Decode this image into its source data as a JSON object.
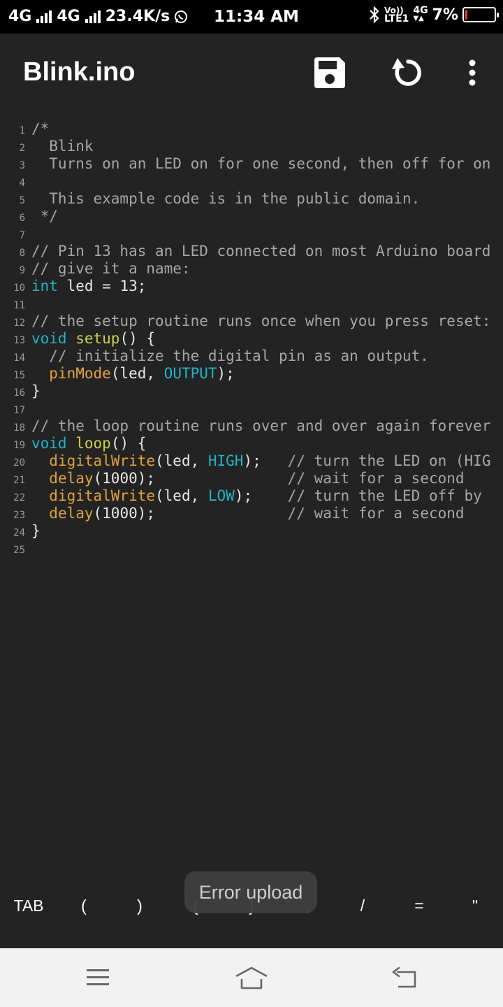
{
  "status_bar": {
    "net1": "4G",
    "net2": "4G",
    "speed": "23.4K/s",
    "time": "11:34 AM",
    "volte_top": "Vo))",
    "volte_bottom": "LTE1",
    "net3": "4G",
    "battery": "7%",
    "battery_level": 0.07,
    "battery_color": "#e53935"
  },
  "toolbar": {
    "title": "Blink.ino",
    "save_icon": "save-icon",
    "refresh_icon": "refresh-icon",
    "more_icon": "more-vertical-icon"
  },
  "code_lines": [
    {
      "num": "1",
      "parts": [
        {
          "t": "/*",
          "c": "c"
        }
      ]
    },
    {
      "num": "2",
      "parts": [
        {
          "t": "  Blink",
          "c": "c"
        }
      ]
    },
    {
      "num": "3",
      "parts": [
        {
          "t": "  Turns on an LED on for one second, then off for on",
          "c": "c"
        }
      ]
    },
    {
      "num": "4",
      "parts": []
    },
    {
      "num": "5",
      "parts": [
        {
          "t": "  This example code is in the public domain.",
          "c": "c"
        }
      ]
    },
    {
      "num": "6",
      "parts": [
        {
          "t": " */",
          "c": "c"
        }
      ]
    },
    {
      "num": "7",
      "parts": []
    },
    {
      "num": "8",
      "parts": [
        {
          "t": "// Pin 13 has an LED connected on most Arduino board",
          "c": "c"
        }
      ]
    },
    {
      "num": "9",
      "parts": [
        {
          "t": "// give it a name:",
          "c": "c"
        }
      ]
    },
    {
      "num": "10",
      "parts": [
        {
          "t": "int",
          "c": "k"
        },
        {
          "t": " led = 13;",
          "c": ""
        }
      ]
    },
    {
      "num": "11",
      "parts": []
    },
    {
      "num": "12",
      "parts": [
        {
          "t": "// the setup routine runs once when you press reset:",
          "c": "c"
        }
      ]
    },
    {
      "num": "13",
      "parts": [
        {
          "t": "void",
          "c": "k"
        },
        {
          "t": " ",
          "c": ""
        },
        {
          "t": "setup",
          "c": "fn"
        },
        {
          "t": "() {",
          "c": ""
        }
      ]
    },
    {
      "num": "14",
      "parts": [
        {
          "t": "  // initialize the digital pin as an output.",
          "c": "c"
        }
      ]
    },
    {
      "num": "15",
      "parts": [
        {
          "t": "  ",
          "c": ""
        },
        {
          "t": "pinMode",
          "c": "f"
        },
        {
          "t": "(led, ",
          "c": ""
        },
        {
          "t": "OUTPUT",
          "c": "k"
        },
        {
          "t": ");",
          "c": ""
        }
      ]
    },
    {
      "num": "16",
      "parts": [
        {
          "t": "}",
          "c": ""
        }
      ]
    },
    {
      "num": "17",
      "parts": []
    },
    {
      "num": "18",
      "parts": [
        {
          "t": "// the loop routine runs over and over again forever",
          "c": "c"
        }
      ]
    },
    {
      "num": "19",
      "parts": [
        {
          "t": "void",
          "c": "k"
        },
        {
          "t": " ",
          "c": ""
        },
        {
          "t": "loop",
          "c": "fn"
        },
        {
          "t": "() {",
          "c": ""
        }
      ]
    },
    {
      "num": "20",
      "parts": [
        {
          "t": "  ",
          "c": ""
        },
        {
          "t": "digitalWrite",
          "c": "f"
        },
        {
          "t": "(led, ",
          "c": ""
        },
        {
          "t": "HIGH",
          "c": "k"
        },
        {
          "t": ");   ",
          "c": ""
        },
        {
          "t": "// turn the LED on (HIG",
          "c": "c"
        }
      ]
    },
    {
      "num": "21",
      "parts": [
        {
          "t": "  ",
          "c": ""
        },
        {
          "t": "delay",
          "c": "f"
        },
        {
          "t": "(1000);               ",
          "c": ""
        },
        {
          "t": "// wait for a second",
          "c": "c"
        }
      ]
    },
    {
      "num": "22",
      "parts": [
        {
          "t": "  ",
          "c": ""
        },
        {
          "t": "digitalWrite",
          "c": "f"
        },
        {
          "t": "(led, ",
          "c": ""
        },
        {
          "t": "LOW",
          "c": "k"
        },
        {
          "t": ");    ",
          "c": ""
        },
        {
          "t": "// turn the LED off by",
          "c": "c"
        }
      ]
    },
    {
      "num": "23",
      "parts": [
        {
          "t": "  ",
          "c": ""
        },
        {
          "t": "delay",
          "c": "f"
        },
        {
          "t": "(1000);               ",
          "c": ""
        },
        {
          "t": "// wait for a second",
          "c": "c"
        }
      ]
    },
    {
      "num": "24",
      "parts": [
        {
          "t": "}",
          "c": ""
        }
      ]
    },
    {
      "num": "25",
      "parts": []
    }
  ],
  "toast": {
    "text": "Error upload"
  },
  "symbols": [
    {
      "label": "TAB",
      "name": "tab"
    },
    {
      "label": "(",
      "name": "open-paren"
    },
    {
      "label": ")",
      "name": "close-paren"
    },
    {
      "label": "{",
      "name": "open-brace"
    },
    {
      "label": "}",
      "name": "close-brace"
    },
    {
      "label": ";",
      "name": "semicolon"
    },
    {
      "label": "/",
      "name": "slash"
    },
    {
      "label": "=",
      "name": "equals"
    },
    {
      "label": "\"",
      "name": "quote"
    }
  ],
  "navbar": {
    "menu_icon": "menu-icon",
    "home_icon": "home-icon",
    "back_icon": "back-icon"
  }
}
